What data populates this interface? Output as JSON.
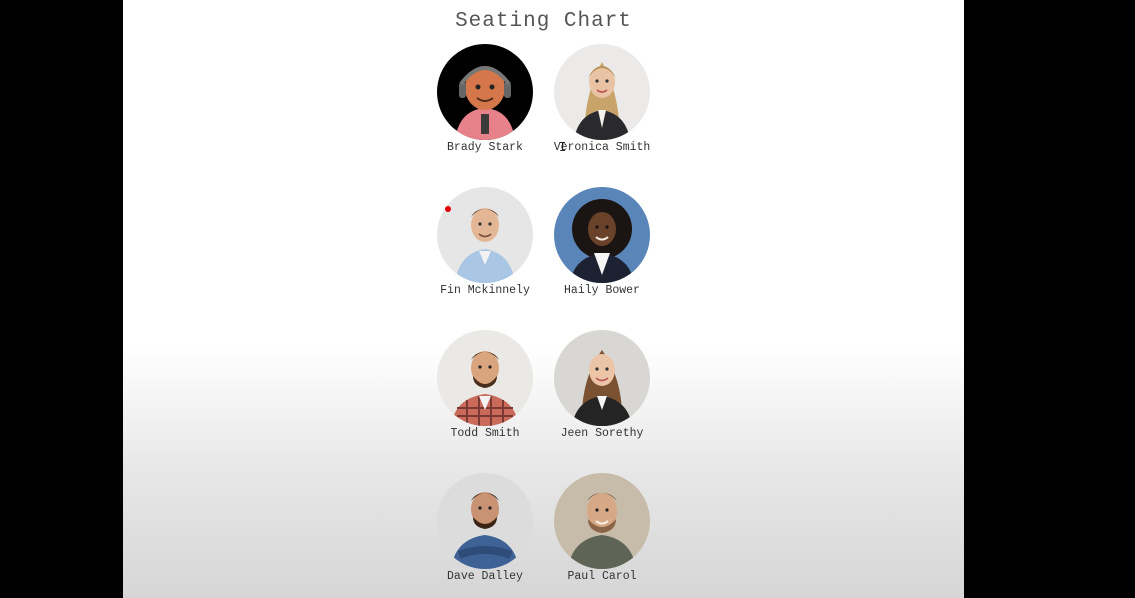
{
  "page": {
    "title": "Seating Chart"
  },
  "seats": [
    {
      "name": "Brady Stark"
    },
    {
      "name": "Veronica Smith"
    },
    {
      "name": "Fin Mckinnely"
    },
    {
      "name": "Haily Bower"
    },
    {
      "name": "Todd Smith"
    },
    {
      "name": "Jeen Sorethy"
    },
    {
      "name": "Dave Dalley"
    },
    {
      "name": "Paul Carol"
    }
  ],
  "colors": {
    "background": "#000000",
    "page": "#ffffff",
    "marker": "#e00000"
  },
  "icons": {
    "cursor": "text-cursor-icon"
  }
}
